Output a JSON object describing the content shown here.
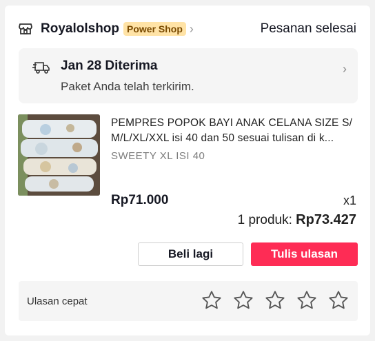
{
  "header": {
    "shop_icon": "storefront-icon",
    "shop_name": "Royalolshop",
    "badge": "Power Shop",
    "badge_color": "#ffe3a6",
    "chevron": "›",
    "order_status": "Pesanan selesai"
  },
  "delivery": {
    "icon": "truck-icon",
    "title": "Jan 28 Diterima",
    "subtitle": "Paket Anda telah terkirim.",
    "chevron": "›"
  },
  "product": {
    "title": "PEMPRES POPOK BAYI ANAK CELANA SIZE S/ M/L/XL/XXL isi 40 dan 50 sesuai tulisan di k...",
    "variant": "SWEETY XL ISI 40",
    "price": "Rp71.000",
    "quantity": "x1"
  },
  "summary": {
    "label": "1 produk:",
    "total": "Rp73.427"
  },
  "actions": {
    "buy_again": "Beli lagi",
    "write_review": "Tulis ulasan",
    "accent_color": "#fe2c55"
  },
  "quick_review": {
    "label": "Ulasan cepat",
    "stars": 5,
    "star_icon": "star-outline-icon"
  }
}
